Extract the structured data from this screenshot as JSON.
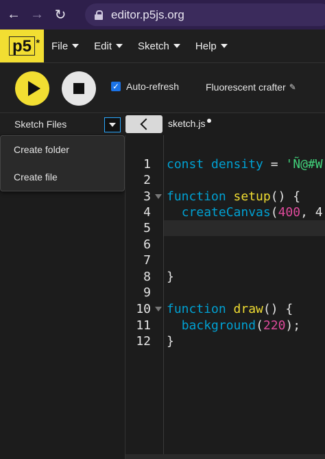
{
  "browser": {
    "url": "editor.p5js.org"
  },
  "nav": {
    "logo": "p5",
    "logo_mark": "*",
    "menu": [
      "File",
      "Edit",
      "Sketch",
      "Help"
    ]
  },
  "toolbar": {
    "autorefresh_label": "Auto-refresh",
    "autorefresh_checked": true,
    "sketch_name": "Fluorescent crafter"
  },
  "files": {
    "header": "Sketch Files",
    "menu": [
      "Create folder",
      "Create file"
    ]
  },
  "editor": {
    "tab": "sketch.js",
    "line_numbers": [
      "1",
      "2",
      "3",
      "4",
      "5",
      "6",
      "7",
      "8",
      "9",
      "10",
      "11",
      "12"
    ],
    "code": {
      "l1_kw": "const",
      "l1_name": "density",
      "l1_op": " = ",
      "l1_str": "'Ñ@#W",
      "l3_kw": "function",
      "l3_name": "setup",
      "l3_rest": "() {",
      "l4_call": "createCanvas",
      "l4_open": "(",
      "l4_num": "400",
      "l4_rest": ", 4",
      "l8": "}",
      "l10_kw": "function",
      "l10_name": "draw",
      "l10_rest": "() {",
      "l11_call": "background",
      "l11_open": "(",
      "l11_num": "220",
      "l11_rest": ");",
      "l12": "}"
    }
  },
  "colors": {
    "accent": "#f2de32",
    "browser_bar": "#2e1f4b",
    "keyword": "#00a1d3",
    "string": "#41d17a",
    "number": "#de4a9b"
  }
}
